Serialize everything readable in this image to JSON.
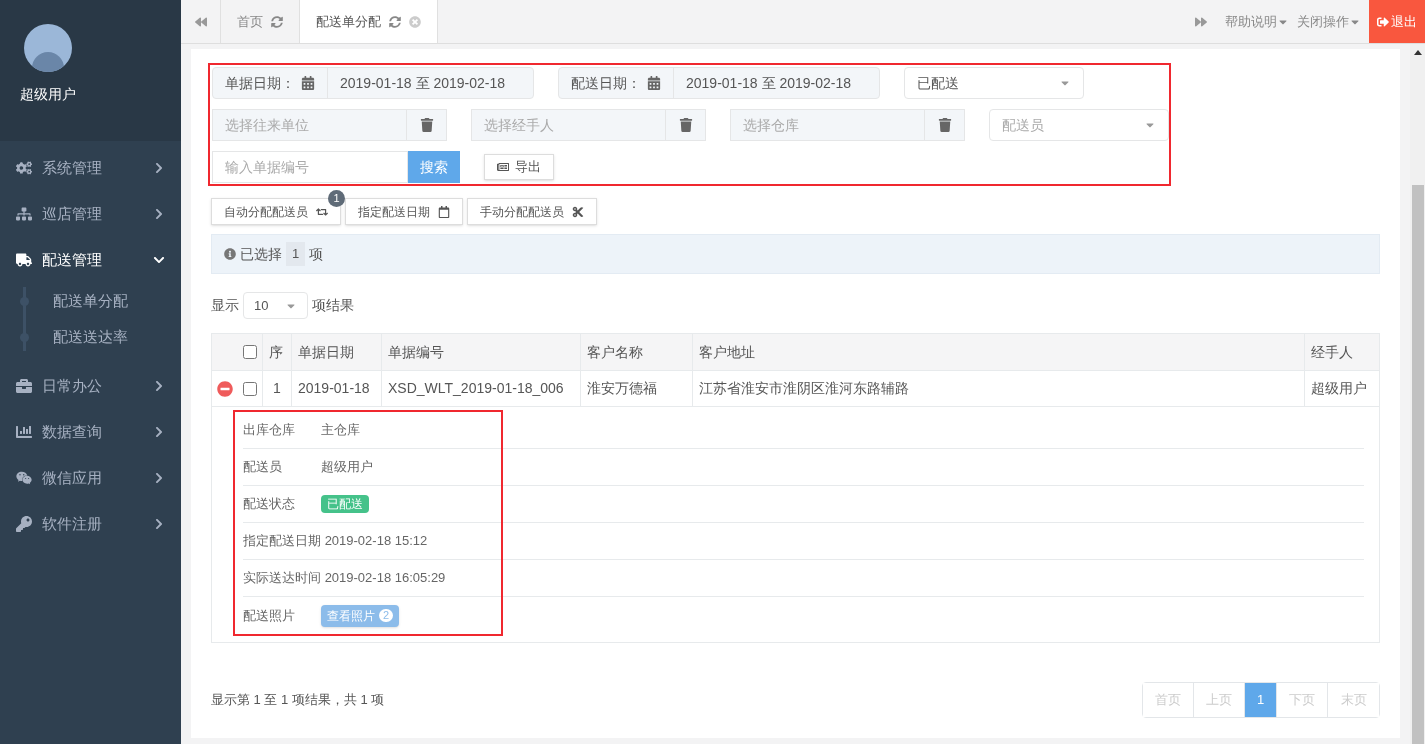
{
  "sidebar": {
    "user": {
      "name": "超级用户"
    },
    "items": [
      {
        "label": "系统管理",
        "expanded": false
      },
      {
        "label": "巡店管理",
        "expanded": false
      },
      {
        "label": "配送管理",
        "expanded": true,
        "children": [
          {
            "label": "配送单分配"
          },
          {
            "label": "配送送达率"
          }
        ]
      },
      {
        "label": "日常办公",
        "expanded": false
      },
      {
        "label": "数据查询",
        "expanded": false
      },
      {
        "label": "微信应用",
        "expanded": false
      },
      {
        "label": "软件注册",
        "expanded": false
      }
    ]
  },
  "tabs": [
    {
      "label": "首页",
      "selected": false
    },
    {
      "label": "配送单分配",
      "selected": true
    }
  ],
  "top_menu": [
    "帮助说明",
    "关闭操作"
  ],
  "logout": "退出",
  "filters": {
    "date_ranges": [
      {
        "label": "单据日期：",
        "value": "2019-01-18 至 2019-02-18"
      },
      {
        "label": "配送日期：",
        "value": "2019-01-18 至 2019-02-18"
      }
    ],
    "status_select": {
      "value": "已配送"
    },
    "pickers": [
      {
        "placeholder": "选择往来单位"
      },
      {
        "placeholder": "选择经手人"
      },
      {
        "placeholder": "选择仓库"
      }
    ],
    "courier_select": {
      "placeholder": "配送员"
    },
    "code_input": {
      "placeholder": "输入单据编号"
    },
    "search_button": "搜索",
    "export_button": "导出"
  },
  "actions": [
    {
      "label": "自动分配配送员",
      "badge": "1"
    },
    {
      "label": "指定配送日期"
    },
    {
      "label": "手动分配配送员"
    }
  ],
  "selection_info": {
    "prefix": "已选择",
    "count": "1",
    "suffix": "项"
  },
  "page_length": {
    "prefix": "显示",
    "value": "10",
    "suffix": "项结果"
  },
  "table": {
    "header_checked": false,
    "columns": [
      "序",
      "单据日期",
      "单据编号",
      "客户名称",
      "客户地址",
      "经手人"
    ],
    "rows": [
      {
        "expanded": true,
        "checked": false,
        "cells": [
          "1",
          "2019-01-18",
          "XSD_WLT_2019-01-18_006",
          "淮安万德福",
          "江苏省淮安市淮阴区淮河东路辅路",
          "超级用户"
        ],
        "details": [
          {
            "kind": "text",
            "label": "出库仓库",
            "value": "主仓库"
          },
          {
            "kind": "text",
            "label": "配送员",
            "value": "超级用户"
          },
          {
            "kind": "badge",
            "label": "配送状态",
            "value": "已配送"
          },
          {
            "kind": "inline",
            "label": "指定配送日期",
            "value": "2019-02-18 15:12"
          },
          {
            "kind": "inline",
            "label": "实际送达时间",
            "value": "2019-02-18 16:05:29"
          },
          {
            "kind": "button",
            "label": "配送照片",
            "value": "查看照片",
            "count": "2"
          }
        ]
      }
    ]
  },
  "footer": {
    "info": "显示第 1 至 1 项结果，共 1 项",
    "pagination": [
      {
        "label": "首页",
        "selected": false,
        "disabled": true
      },
      {
        "label": "上页",
        "selected": false,
        "disabled": true
      },
      {
        "label": "1",
        "selected": true,
        "disabled": false
      },
      {
        "label": "下页",
        "selected": false,
        "disabled": true
      },
      {
        "label": "末页",
        "selected": false,
        "disabled": true
      }
    ]
  }
}
